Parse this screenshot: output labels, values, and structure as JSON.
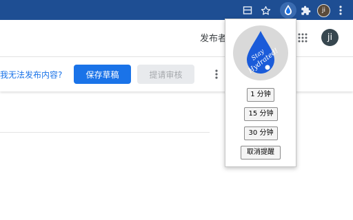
{
  "browser": {
    "toolbar_color": "#1e4e93",
    "profile_initial": "ji",
    "icons": [
      "tab-search-icon",
      "star-icon",
      "stay-hydrated-extension-icon",
      "extensions-puzzle-icon",
      "profile-avatar",
      "more-vert-icon"
    ]
  },
  "page": {
    "publisher_text": "发布者",
    "avatar_initial": "ji",
    "help_link": "我无法发布内容?",
    "save_draft": "保存草稿",
    "submit_review": "提请审核",
    "accent_color": "#1a73e8"
  },
  "popup": {
    "logo_line1": "Stay",
    "logo_line2": "Hydrated!",
    "buttons": [
      "1 分钟",
      "15 分钟",
      "30 分钟",
      "取消提醒"
    ]
  }
}
